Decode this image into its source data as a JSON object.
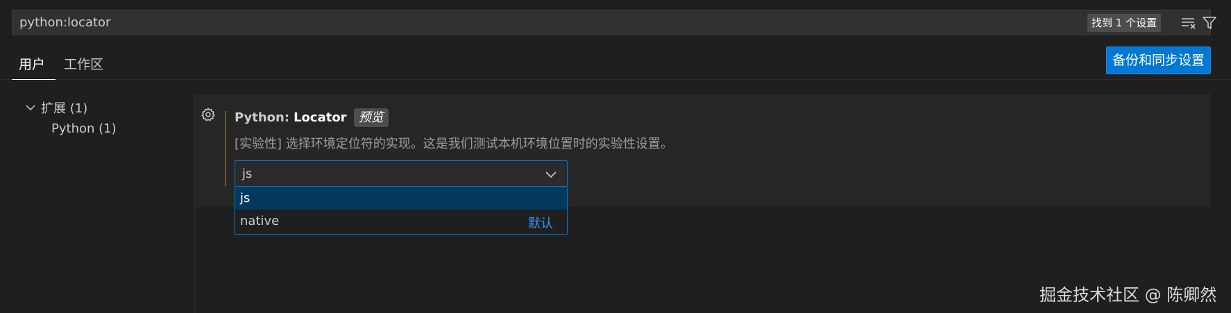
{
  "search": {
    "value": "python:locator",
    "result_badge": "找到 1 个设置",
    "clear_icon": "clear-filter-icon",
    "filter_icon": "filter-icon"
  },
  "tabs": [
    {
      "label": "用户",
      "active": true
    },
    {
      "label": "工作区",
      "active": false
    }
  ],
  "sync_button": {
    "label": "备份和同步设置",
    "color": "#0078d4"
  },
  "tree": {
    "extensions": {
      "label": "扩展 (1)",
      "icon": "chevron-down-icon"
    },
    "python": {
      "label": "Python (1)"
    }
  },
  "setting": {
    "gear_icon": "gear-icon",
    "category": "Python:",
    "name": "Locator",
    "preview_badge": "预览",
    "description": "[实验性] 选择环境定位符的实现。这是我们测试本机环境位置时的实验性设置。",
    "selected_value": "js",
    "options": [
      {
        "label": "js",
        "highlighted": true
      },
      {
        "label": "native",
        "tag": "默认"
      }
    ]
  },
  "watermark": "掘金技术社区 @ 陈卿然",
  "colors": {
    "accent": "#0078d4",
    "selection": "#04395e",
    "default_tag": "#3794ff"
  }
}
